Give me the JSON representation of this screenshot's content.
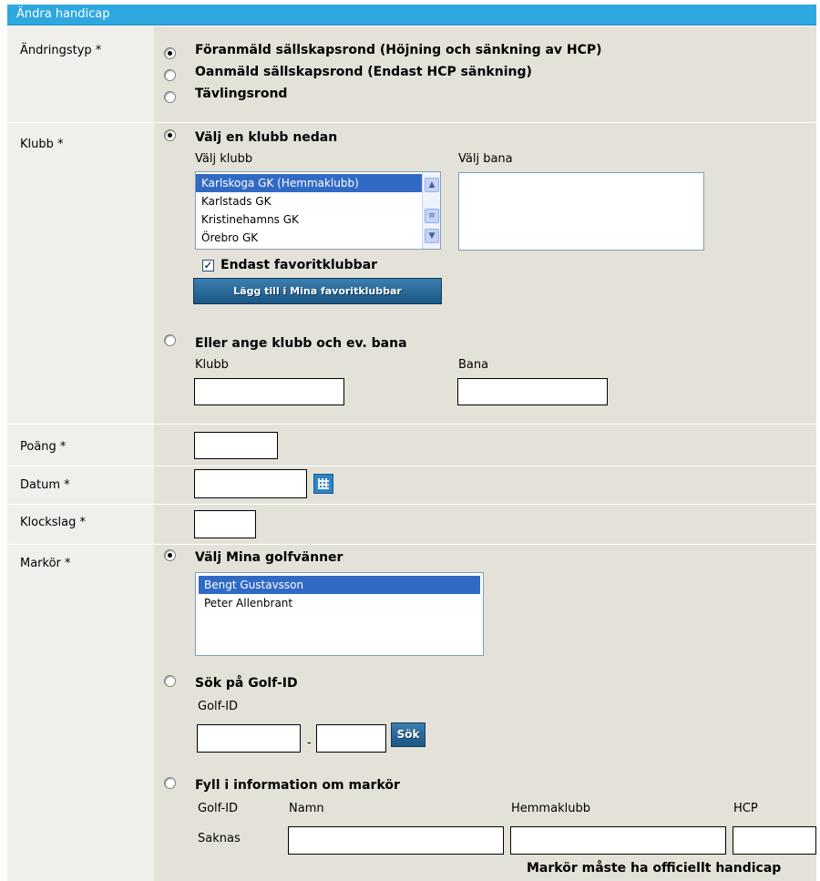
{
  "header": {
    "title": "Ändra handicap"
  },
  "andringstyp": {
    "label": "Ändringstyp *",
    "options": [
      "Föranmäld sällskapsrond (Höjning och sänkning av HCP)",
      "Oanmäld sällskapsrond (Endast HCP sänkning)",
      "Tävlingsrond"
    ],
    "selected_index": 0
  },
  "klubb": {
    "label": "Klubb *",
    "option_select": "Välj en klubb nedan",
    "valj_klubb_label": "Välj klubb",
    "valj_bana_label": "Välj bana",
    "clubs": [
      "Karlskoga GK (Hemmaklubb)",
      "Karlstads GK",
      "Kristinehamns GK",
      "Örebro GK"
    ],
    "selected_club_index": 0,
    "favorites_checkbox_label": "Endast favoritklubbar",
    "favorites_checked": true,
    "add_favorite_button": "Lägg till i Mina favoritklubbar",
    "option_manual": "Eller ange klubb och ev. bana",
    "manual_klubb_label": "Klubb",
    "manual_bana_label": "Bana"
  },
  "poang": {
    "label": "Poäng *"
  },
  "datum": {
    "label": "Datum *"
  },
  "klockslag": {
    "label": "Klockslag *"
  },
  "markor": {
    "label": "Markör *",
    "option_friends": "Välj Mina golfvänner",
    "friends": [
      "Bengt Gustavsson",
      "Peter Allenbrant"
    ],
    "selected_friend_index": 0,
    "option_golfid": "Sök på Golf-ID",
    "golfid_label": "Golf-ID",
    "golfid_dash": "-",
    "search_button": "Sök",
    "option_manual": "Fyll i information om markör",
    "col_golfid": "Golf-ID",
    "col_namn": "Namn",
    "col_hemmaklubb": "Hemmaklubb",
    "col_hcp": "HCP",
    "golfid_value": "Saknas",
    "note": "Markör måste ha officiellt handicap"
  },
  "colors": {
    "header": "#2fa8e0",
    "label_bg": "#f0efec",
    "control_bg": "#e4e2d8",
    "selection": "#316ac5"
  }
}
